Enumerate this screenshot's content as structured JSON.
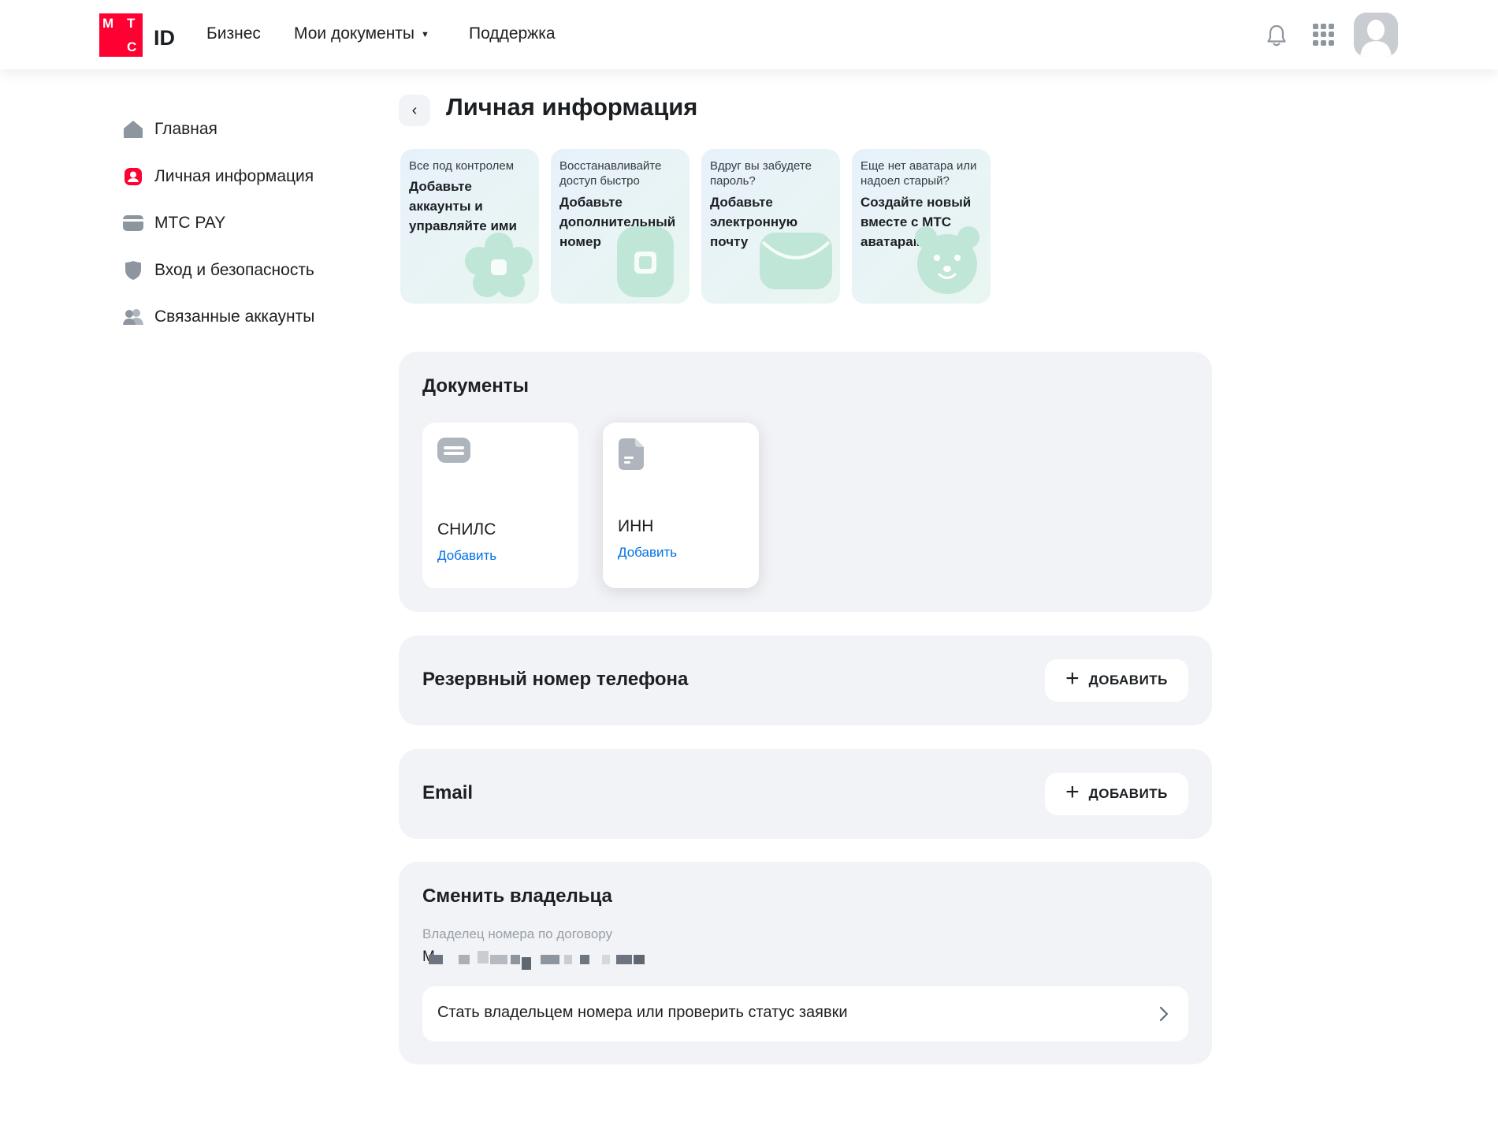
{
  "header": {
    "logo_letters": [
      "М",
      "Т",
      "С"
    ],
    "logo_id": "ID",
    "nav": {
      "business": "Бизнес",
      "my_documents": "Мои документы",
      "support": "Поддержка"
    }
  },
  "sidebar": {
    "items": [
      {
        "label": "Главная",
        "icon": "home-icon"
      },
      {
        "label": "Личная информация",
        "icon": "person-icon"
      },
      {
        "label": "МТС PAY",
        "icon": "card-icon"
      },
      {
        "label": "Вход и безопасность",
        "icon": "shield-icon"
      },
      {
        "label": "Связанные аккаунты",
        "icon": "people-icon"
      }
    ]
  },
  "page": {
    "title": "Личная информация"
  },
  "promos": [
    {
      "small": "Все под контролем",
      "big": "Добавьте аккаунты и управляйте ими",
      "icon": "flower-icon"
    },
    {
      "small": "Восстанавливайте доступ быстро",
      "big": "Добавьте дополнительный номер",
      "icon": "phone-icon"
    },
    {
      "small": "Вдруг вы забудете пароль?",
      "big": "Добавьте электронную почту",
      "icon": "envelope-icon"
    },
    {
      "small": "Еще нет аватара или надоел старый?",
      "big": "Создайте новый вместе с МТС аватарами",
      "icon": "bear-icon"
    }
  ],
  "documents": {
    "title": "Документы",
    "cards": [
      {
        "name": "СНИЛС",
        "action": "Добавить",
        "icon": "snils-card-icon"
      },
      {
        "name": "ИНН",
        "action": "Добавить",
        "icon": "document-icon"
      }
    ]
  },
  "backup_phone": {
    "title": "Резервный номер телефона",
    "button": "ДОБАВИТЬ"
  },
  "email": {
    "title": "Email",
    "button": "ДОБАВИТЬ"
  },
  "owner": {
    "title": "Сменить владельца",
    "label": "Владелец номера по договору",
    "value_initial": "М",
    "link": "Стать владельцем номера или проверить статус заявки"
  },
  "colors": {
    "brand": "#ff0032",
    "link": "#0070e5",
    "section_bg": "#f2f3f7",
    "icon_gray": "#8d969f",
    "promo_icon": "#bfe6d6"
  }
}
